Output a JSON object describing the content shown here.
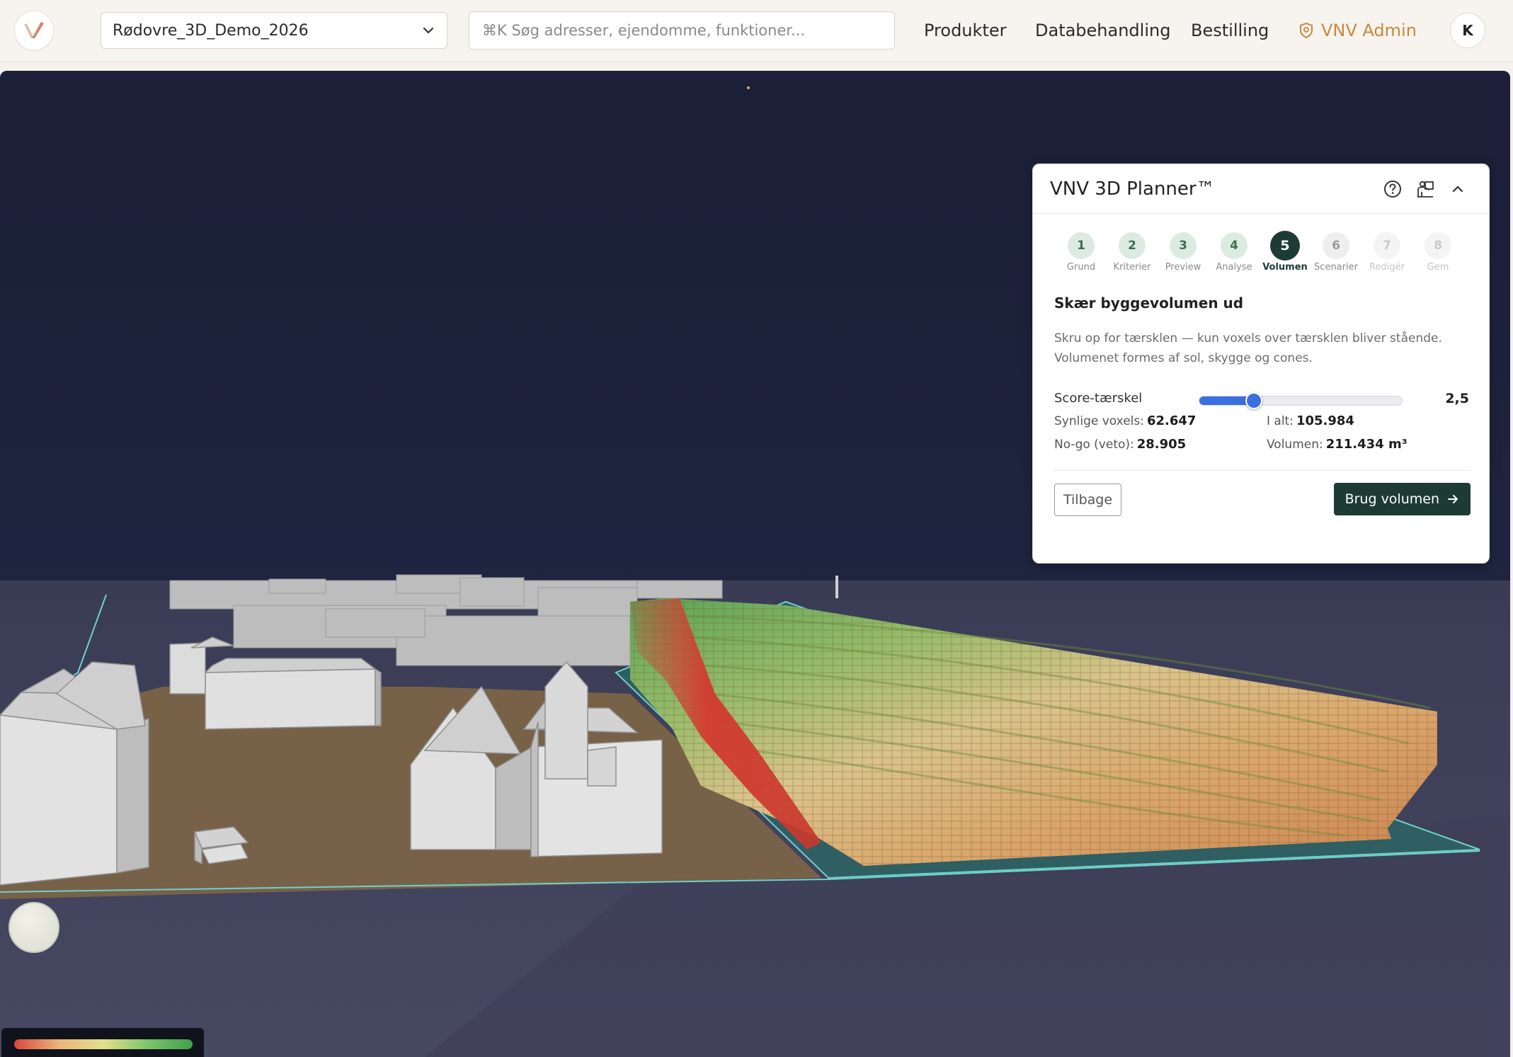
{
  "header": {
    "project": "Rødovre_3D_Demo_2026",
    "search_placeholder": "⌘K Søg adresser, ejendomme, funktioner...",
    "nav": {
      "produkter": "Produkter",
      "databehandling": "Databehandling",
      "bestilling": "Bestilling",
      "admin": "VNV Admin"
    },
    "avatar_initial": "K"
  },
  "planner": {
    "title": "VNV 3D Planner™",
    "steps": [
      {
        "num": "1",
        "label": "Grund",
        "state": "done"
      },
      {
        "num": "2",
        "label": "Kriterier",
        "state": "done"
      },
      {
        "num": "3",
        "label": "Preview",
        "state": "done"
      },
      {
        "num": "4",
        "label": "Analyse",
        "state": "done"
      },
      {
        "num": "5",
        "label": "Volumen",
        "state": "active"
      },
      {
        "num": "6",
        "label": "Scenarier",
        "state": "todo"
      },
      {
        "num": "7",
        "label": "Redigér",
        "state": "disabled"
      },
      {
        "num": "8",
        "label": "Gem",
        "state": "disabled"
      }
    ],
    "section_title": "Skær byggevolumen ud",
    "description": "Skru op for tærsklen — kun voxels over tærsklen bliver stående. Volumenet formes af sol, skygge og cones.",
    "threshold_label": "Score-tærskel",
    "threshold_value": "2,5",
    "threshold_fraction": 0.27,
    "stats": {
      "visible_label": "Synlige voxels:",
      "visible_value": "62.647",
      "total_label": "I alt:",
      "total_value": "105.984",
      "nogo_label": "No-go (veto):",
      "nogo_value": "28.905",
      "volume_label": "Volumen:",
      "volume_value": "211.434 m³"
    },
    "back_label": "Tilbage",
    "use_label": "Brug volumen"
  },
  "colors": {
    "accent": "#1e3b33",
    "slider": "#3b6fe0",
    "admin": "#c9893a",
    "sky": "#1b1f36",
    "legend_gradient": [
      "#d9463d",
      "#e9b57a",
      "#e3e08a",
      "#7cc46a",
      "#3fa04a"
    ]
  },
  "icons": {
    "help": "help-circle-icon",
    "tour": "person-chalkboard-icon",
    "collapse": "chevron-up-icon",
    "arrow": "arrow-right-icon",
    "shield": "shield-icon",
    "logo": "v-logo-icon"
  }
}
